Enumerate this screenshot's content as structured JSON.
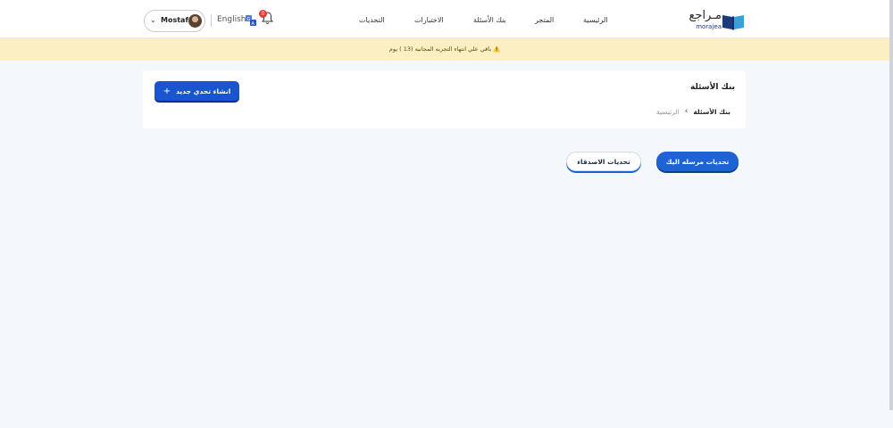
{
  "header": {
    "user_name": "Mostafa",
    "language": "English",
    "notification_count": "0",
    "nav": {
      "home": "الرئيسية",
      "store": "المتجر",
      "question_bank": "بنك الأسئلة",
      "exams": "الاختبارات",
      "challenges": "التحديات"
    },
    "logo_ar": "مـراجع",
    "logo_en": "morajea"
  },
  "banner": {
    "text": "⚠️ باقي علي انتهاء التجربه المجانيه (13 ) يوم"
  },
  "page": {
    "title": "بنك الأسئلة",
    "breadcrumb_home": "الرئيسية",
    "breadcrumb_separator": "›",
    "breadcrumb_current": "بنك الأسئلة",
    "new_challenge_label": "انشاء تحدي جديد",
    "new_challenge_icon": "+"
  },
  "tabs": {
    "received_label": "تحديات مرسله اليك",
    "friends_label": "تحديات الاصدقاء"
  },
  "colors": {
    "primary": "#1955cf",
    "banner_bg": "#fdefc4",
    "badge": "#e53935"
  }
}
